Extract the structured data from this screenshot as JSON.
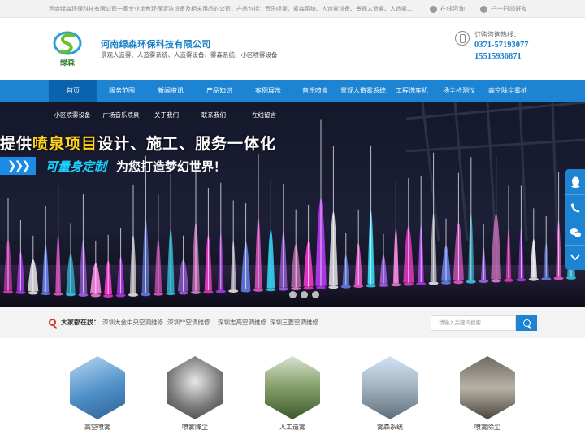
{
  "topbar": {
    "intro": "河南绿森环保科技有限公司一家专业销售环保清洁设备及相关用品的公司，产品包括：音乐喷泉、雾森系统、人造雾设备、景观人造雾、人造雾...",
    "online": "在线咨询",
    "wechat": "扫一扫加好友"
  },
  "header": {
    "logo_text": "绿森",
    "brand": "河南绿森环保科技有限公司",
    "tagline": "景观人造雾、人造雾系统、人造雾设备、雾森系统、小区喷雾设备",
    "hotline_label": "订购咨询热线：",
    "phone1": "0371-57193077",
    "phone2": "15515936871"
  },
  "nav": [
    {
      "label": "首页"
    },
    {
      "label": "服务范围"
    },
    {
      "label": "新闻资讯"
    },
    {
      "label": "产品知识"
    },
    {
      "label": "案例展示"
    },
    {
      "label": "音乐喷泉"
    },
    {
      "label": "景观人造雾系统"
    },
    {
      "label": "工程洗车机"
    },
    {
      "label": "扬尘检测仪"
    },
    {
      "label": "高空除尘雾桩"
    }
  ],
  "subnav": [
    {
      "label": "小区喷雾设备"
    },
    {
      "label": "广场音乐喷泉"
    },
    {
      "label": "关于我们"
    },
    {
      "label": "联系我们"
    },
    {
      "label": "在线留言"
    }
  ],
  "banner": {
    "line1_a": "提供",
    "line1_b": "喷泉项目",
    "line1_c": "设计、施工、服务一体化",
    "arrows": "❯❯❯",
    "line2_a": "可量身定制",
    "line2_b": "为您打造梦幻世界！"
  },
  "search": {
    "label": "大家都在找：",
    "keywords": [
      "深圳大金中央空调维修",
      "深圳**空调维修",
      "深圳志高空调维修",
      "深圳三菱空调维修"
    ],
    "placeholder": "请输入关键词搜索"
  },
  "products": [
    {
      "label": "高空喷雾"
    },
    {
      "label": "喷雾降尘"
    },
    {
      "label": "人工造雾"
    },
    {
      "label": "雾森系统"
    },
    {
      "label": "喷雾除尘"
    }
  ],
  "side_icons": [
    "qq-icon",
    "phone-icon",
    "wechat-icon",
    "chevron-down-icon"
  ],
  "colors": {
    "brand": "#1c84d2",
    "nav_active": "#0c63ad",
    "highlight": "#ffd21c"
  }
}
